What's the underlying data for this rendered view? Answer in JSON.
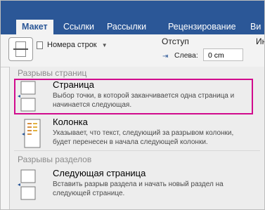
{
  "tabs": [
    {
      "label": "Макет",
      "active": true
    },
    {
      "label": "Ссылки",
      "active": false
    },
    {
      "label": "Рассылки",
      "active": false
    },
    {
      "label": "Рецензирование",
      "active": false
    },
    {
      "label": "Ви",
      "active": false
    }
  ],
  "toolbar": {
    "line_numbers_label": "Номера строк",
    "indent_label": "Отступ",
    "left_label": "Слева:",
    "left_value": "0 cm",
    "cut_label": "Ин"
  },
  "menu": {
    "page_breaks_title": "Разрывы страниц",
    "section_breaks_title": "Разрывы разделов",
    "items": [
      {
        "title": "Страница",
        "description": "Выбор точки, в которой заканчивается одна страница и начинается следующая."
      },
      {
        "title": "Колонка",
        "description": "Указывает, что текст, следующий за разрывом колонки, будет перенесен в начала следующей колонки."
      },
      {
        "title": "Следующая страница",
        "description": "Вставить разрыв раздела и начать новый раздел на следующей странице."
      }
    ]
  },
  "colors": {
    "ribbon": "#2b5797",
    "highlight": "#d10b8d"
  }
}
